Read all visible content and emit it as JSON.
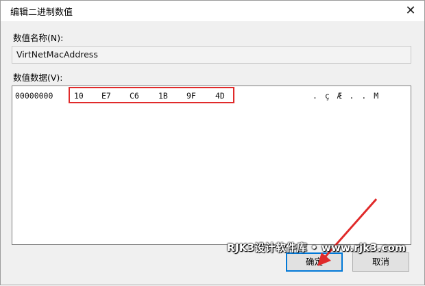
{
  "window": {
    "title": "编辑二进制数值",
    "close_symbol": "✕"
  },
  "value_name": {
    "label": "数值名称(N):",
    "value": "VirtNetMacAddress"
  },
  "value_data": {
    "label": "数值数据(V):",
    "offset": "00000000",
    "bytes": [
      "10",
      "E7",
      "C6",
      "1B",
      "9F",
      "4D"
    ],
    "ascii": ". ç Æ . . M"
  },
  "buttons": {
    "ok_label": "确定",
    "cancel_label": "取消"
  },
  "watermark": {
    "text": "RJK3设计软件库 • www.rjk3.com"
  },
  "colors": {
    "highlight": "#e02a2a",
    "focus_border": "#0078d7"
  }
}
